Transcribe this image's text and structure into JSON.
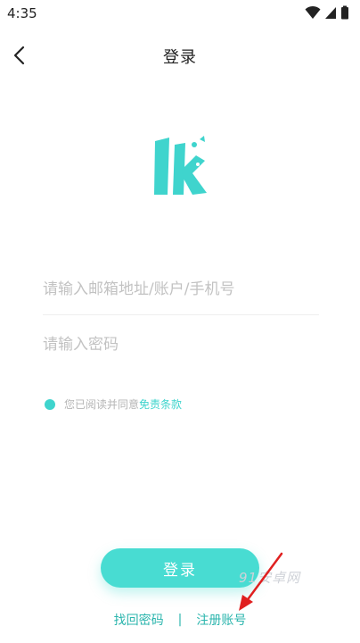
{
  "status_bar": {
    "time": "4:35",
    "icons": [
      "wifi-icon",
      "signal-icon",
      "battery-icon"
    ]
  },
  "header": {
    "title": "登录",
    "back_icon": "chevron-left-icon"
  },
  "logo": {
    "name": "lk-logo",
    "color": "#3fd4cd"
  },
  "form": {
    "account_placeholder": "请输入邮箱地址/账户/手机号",
    "account_value": "",
    "password_placeholder": "请输入密码",
    "password_value": ""
  },
  "agreement": {
    "text": "您已阅读并同意",
    "link_label": "免责条款"
  },
  "login_button_label": "登录",
  "bottom_links": {
    "forgot_password": "找回密码",
    "separator": "|",
    "register": "注册账号"
  },
  "watermark": "91安卓网",
  "colors": {
    "accent": "#48dcd2",
    "link": "#2bb5ad",
    "annotation": "#e02020"
  }
}
